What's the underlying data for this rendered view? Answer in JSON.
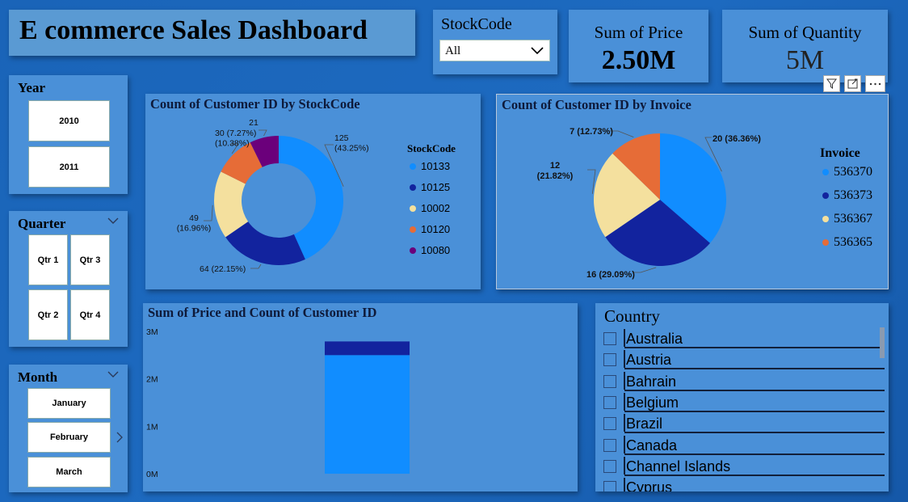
{
  "title": "E commerce Sales Dashboard",
  "stockcode_slicer": {
    "label": "StockCode",
    "selected": "All"
  },
  "kpis": [
    {
      "label": "Sum of Price",
      "value": "2.50M"
    },
    {
      "label": "Sum of Quantity",
      "value": "5M"
    }
  ],
  "year_slicer": {
    "title": "Year",
    "options": [
      "2010",
      "2011"
    ]
  },
  "quarter_slicer": {
    "title": "Quarter",
    "options": [
      "Qtr 1",
      "Qtr 3",
      "Qtr 2",
      "Qtr 4"
    ]
  },
  "month_slicer": {
    "title": "Month",
    "options": [
      "January",
      "February",
      "March"
    ]
  },
  "country_slicer": {
    "title": "Country",
    "options": [
      "Australia",
      "Austria",
      "Bahrain",
      "Belgium",
      "Brazil",
      "Canada",
      "Channel Islands",
      "Cyprus"
    ]
  },
  "colors": {
    "c1": "#118dff",
    "c2": "#12239e",
    "c3": "#f4e09e",
    "c4": "#e66c37",
    "c5": "#6b007b"
  },
  "chart_data": [
    {
      "type": "pie",
      "variant": "donut",
      "title": "Count of Customer ID by StockCode",
      "legend_title": "StockCode",
      "legend_position": "right",
      "categories": [
        "10133",
        "10125",
        "10002",
        "10120",
        "10080"
      ],
      "values": [
        125,
        64,
        49,
        30,
        21
      ],
      "labels": [
        "125\n(43.25%)",
        "64 (22.15%)",
        "49\n(16.96%)",
        "30 (7.27%)\n(10.38%)",
        "21"
      ]
    },
    {
      "type": "pie",
      "title": "Count of Customer ID by Invoice",
      "legend_title": "Invoice",
      "legend_position": "right",
      "categories": [
        "536370",
        "536373",
        "536367",
        "536365"
      ],
      "values": [
        20,
        16,
        12,
        7
      ],
      "labels": [
        "20 (36.36%)",
        "16 (29.09%)",
        "12\n(21.82%)",
        "7 (12.73%)"
      ]
    },
    {
      "type": "bar",
      "stacked": true,
      "title": "Sum of Price and Count of Customer ID",
      "y_ticks": [
        "0M",
        "1M",
        "2M",
        "3M"
      ],
      "ylim": [
        0,
        3000000
      ],
      "series": [
        {
          "values": [
            2500000
          ]
        },
        {
          "values": [
            289000
          ]
        }
      ]
    }
  ]
}
